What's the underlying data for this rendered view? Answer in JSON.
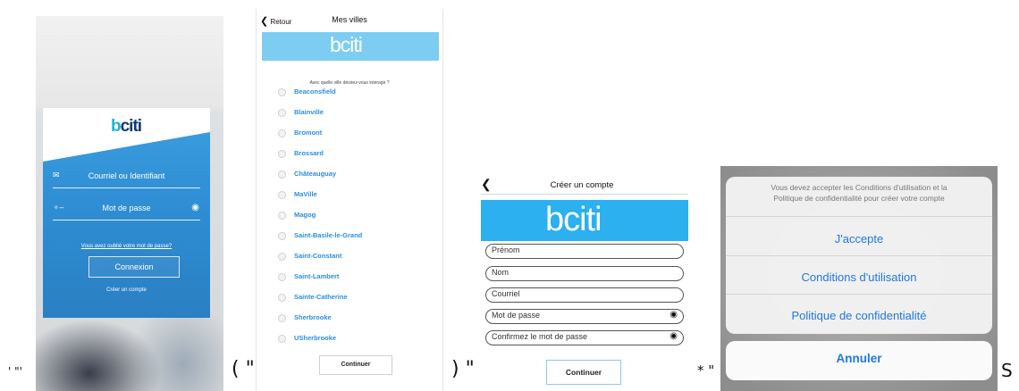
{
  "separators": {
    "s1": "' \"'",
    "s2": "( \"",
    "s3": ") \"",
    "s4": "* \"",
    "s5": "S"
  },
  "login": {
    "logo": {
      "b": "b",
      "rest": "citi"
    },
    "email_placeholder": "Courriel ou Identifiant",
    "password_placeholder": "Mot de passe",
    "forgot_password": "Vous avez oublié votre mot de passe?",
    "connect_button": "Connexion",
    "create_account_link": "Créer un compte"
  },
  "cities": {
    "back_label": "Retour",
    "title": "Mes villes",
    "logo": {
      "b": "b",
      "rest": "citi"
    },
    "question": "Avec quelle ville désirez-vous interagir ?",
    "items": [
      {
        "name": "Beaconsfield"
      },
      {
        "name": "Blainville"
      },
      {
        "name": "Bromont"
      },
      {
        "name": "Brossard"
      },
      {
        "name": "Châteauguay"
      },
      {
        "name": "MaVille"
      },
      {
        "name": "Magog"
      },
      {
        "name": "Saint-Basile-le-Grand"
      },
      {
        "name": "Saint-Constant"
      },
      {
        "name": "Saint-Lambert"
      },
      {
        "name": "Sainte-Catherine"
      },
      {
        "name": "Sherbrooke"
      },
      {
        "name": "USherbrooke"
      }
    ],
    "continue_button": "Continuer"
  },
  "create": {
    "title": "Créer un compte",
    "logo": {
      "b": "b",
      "rest": "citi"
    },
    "fields": {
      "first_name": "Prénom",
      "last_name": "Nom",
      "email": "Courriel",
      "password": "Mot de passe",
      "confirm_password": "Confirmez le mot de passe"
    },
    "continue_button": "Continuer"
  },
  "dialog": {
    "message_line1": "Vous devez accepter les Conditions d'utilisation et la",
    "message_line2": "Politique de confidentialité pour créer votre compte",
    "accept": "J'accepte",
    "terms": "Conditions d'utilisation",
    "privacy": "Politique de confidentialité",
    "cancel": "Annuler"
  },
  "colors": {
    "brand_cyan": "#1fb3d8",
    "brand_navy": "#0d3b6d",
    "login_blue": "#2f8ed4",
    "link_blue": "#2c8ee0",
    "ios_blue": "#1f78e0"
  },
  "icons": [
    "envelope-icon",
    "key-icon",
    "eye-icon",
    "chevron-left-icon"
  ]
}
